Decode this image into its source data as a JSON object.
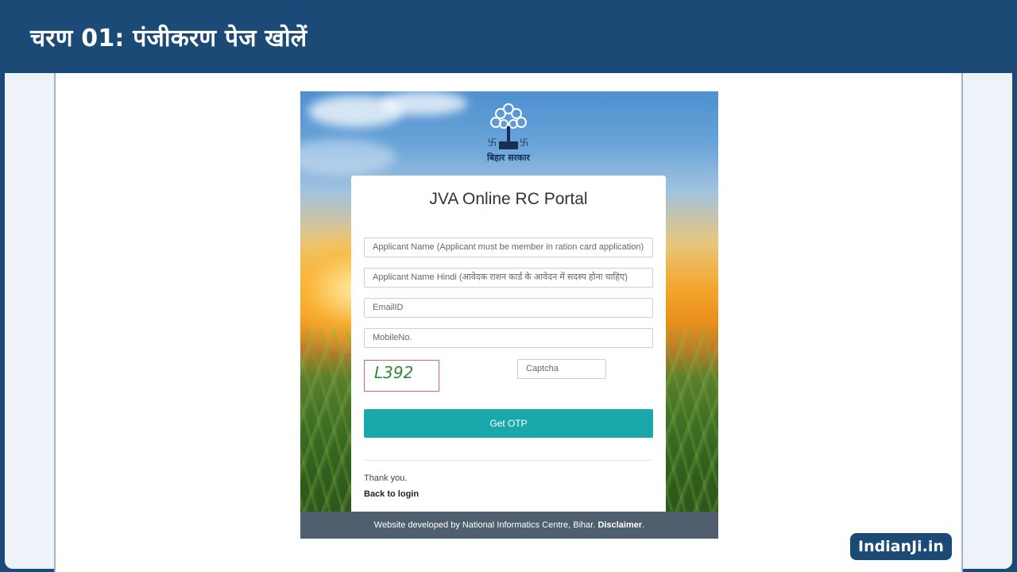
{
  "header": {
    "title": "चरण 01: पंजीकरण पेज खोलें"
  },
  "portal": {
    "emblem_caption": "बिहार सरकार",
    "title": "JVA Online RC Portal",
    "fields": {
      "applicant_name": {
        "placeholder": "Applicant Name (Applicant must be member in ration card application)"
      },
      "applicant_name_hindi": {
        "placeholder": "Applicant Name Hindi (आवेदक राशन कार्ड के आवेदन में सदस्य होना चाहिए)"
      },
      "email": {
        "placeholder": "EmailID"
      },
      "mobile": {
        "placeholder": "MobileNo."
      },
      "captcha": {
        "placeholder": "Captcha"
      }
    },
    "captcha_text": "L392",
    "get_otp_label": "Get OTP",
    "thank_you": "Thank you.",
    "back_to_login": "Back to login",
    "footer_text": "Website developed by National Informatics Centre, Bihar.",
    "footer_link": "Disclaimer",
    "footer_end": "."
  },
  "brand": {
    "label": "IndianJi.in"
  },
  "colors": {
    "header_bg": "#1a4a75",
    "button_bg": "#1ba8aa",
    "footer_bg": "#4f5f6e",
    "captcha_text": "#2e8b3a"
  }
}
